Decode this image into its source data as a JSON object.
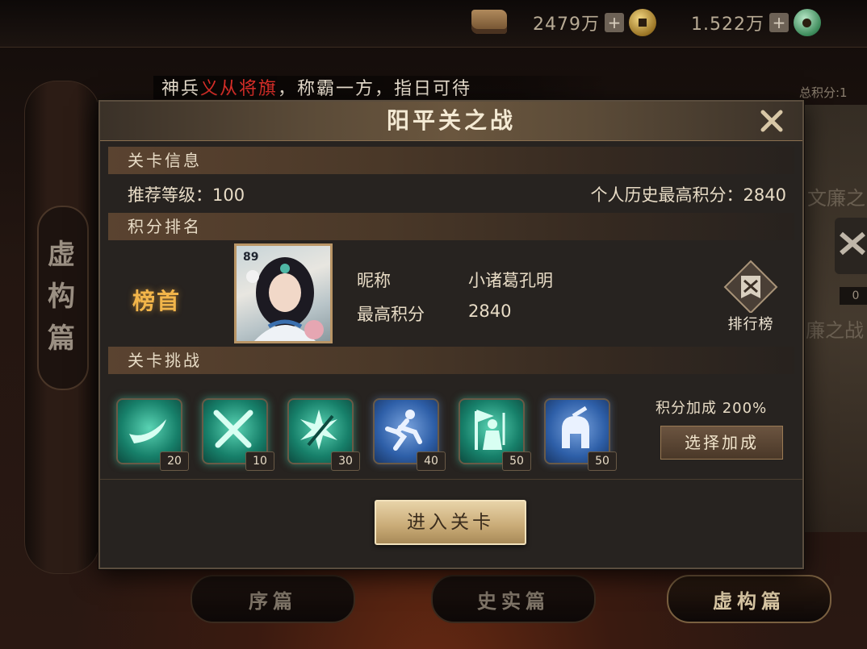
{
  "topbar": {
    "gold_amount": "2479万",
    "jade_amount": "1.522万",
    "plus": "+"
  },
  "marquee": {
    "prefix": "神兵",
    "highlight": "义从将旗",
    "suffix": "，称霸一方，指日可待",
    "highlight_color": "#e0302a"
  },
  "total_score_label": "总积分:1",
  "left_scroll": {
    "title": "虚构篇"
  },
  "bottom_tabs": [
    {
      "label": "序篇",
      "active": false
    },
    {
      "label": "史实篇",
      "active": false
    },
    {
      "label": "虚构篇",
      "active": true
    }
  ],
  "right_map": {
    "label1": "文廉之",
    "label2": "廉之战",
    "badge": "0"
  },
  "dialog": {
    "title": "阳平关之战",
    "sections": {
      "info": "关卡信息",
      "ranking": "积分排名",
      "challenge": "关卡挑战"
    },
    "info": {
      "recommended_level": "推荐等级：100",
      "personal_best": "个人历史最高积分：2840"
    },
    "ranking": {
      "rank_label": "榜首",
      "portrait_level": "89",
      "nickname_label": "昵称",
      "nickname_value": "小诸葛孔明",
      "high_score_label": "最高积分",
      "high_score_value": "2840",
      "leaderboard_label": "排行榜"
    },
    "challenges": [
      {
        "icon": "horn-icon",
        "cost": "20",
        "color": "green"
      },
      {
        "icon": "crossed-swords-icon",
        "cost": "10",
        "color": "green"
      },
      {
        "icon": "sword-burst-icon",
        "cost": "30",
        "color": "green"
      },
      {
        "icon": "running-man-icon",
        "cost": "40",
        "color": "blue"
      },
      {
        "icon": "soldier-flag-icon",
        "cost": "50",
        "color": "green"
      },
      {
        "icon": "helmet-icon",
        "cost": "50",
        "color": "blue"
      }
    ],
    "bonus_text": "积分加成 200%",
    "select_bonus": "选择加成",
    "enter_button": "进入关卡"
  }
}
